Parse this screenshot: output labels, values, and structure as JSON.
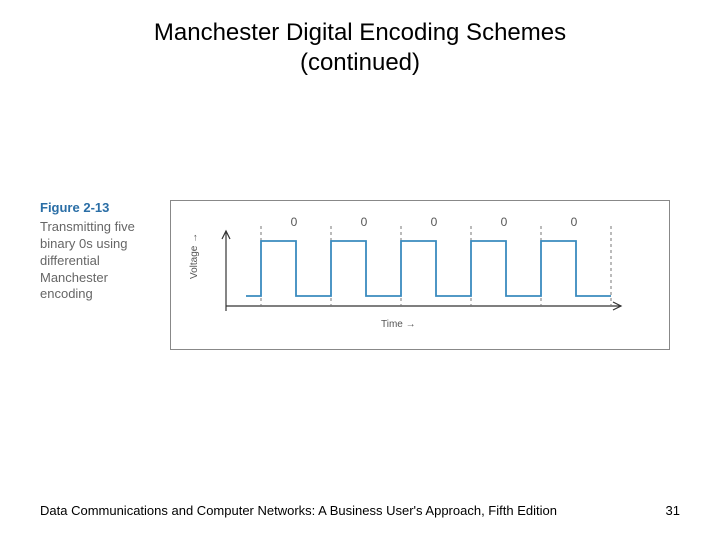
{
  "title_line1": "Manchester Digital Encoding Schemes",
  "title_line2": "(continued)",
  "figure": {
    "number": "Figure 2-13",
    "caption": "Transmitting five binary 0s using differential Manchester encoding",
    "y_axis": "Voltage",
    "x_axis": "Time",
    "bits": [
      "0",
      "0",
      "0",
      "0",
      "0"
    ]
  },
  "footer": {
    "text": "Data Communications and Computer Networks: A Business User's Approach, Fifth Edition",
    "page": "31"
  },
  "chart_data": {
    "type": "line",
    "title": "Differential Manchester encoding of five binary 0s",
    "xlabel": "Time",
    "ylabel": "Voltage",
    "bit_sequence": [
      0,
      0,
      0,
      0,
      0
    ],
    "description": "Square-wave signal; each bit cell has a mid-bit transition. For a 0 there is also a transition at the start of the cell, producing alternating high/low halves repeating each cell.",
    "levels": [
      "low",
      "high",
      "low",
      "high",
      "low",
      "high",
      "low",
      "high",
      "low",
      "high",
      "low"
    ]
  }
}
